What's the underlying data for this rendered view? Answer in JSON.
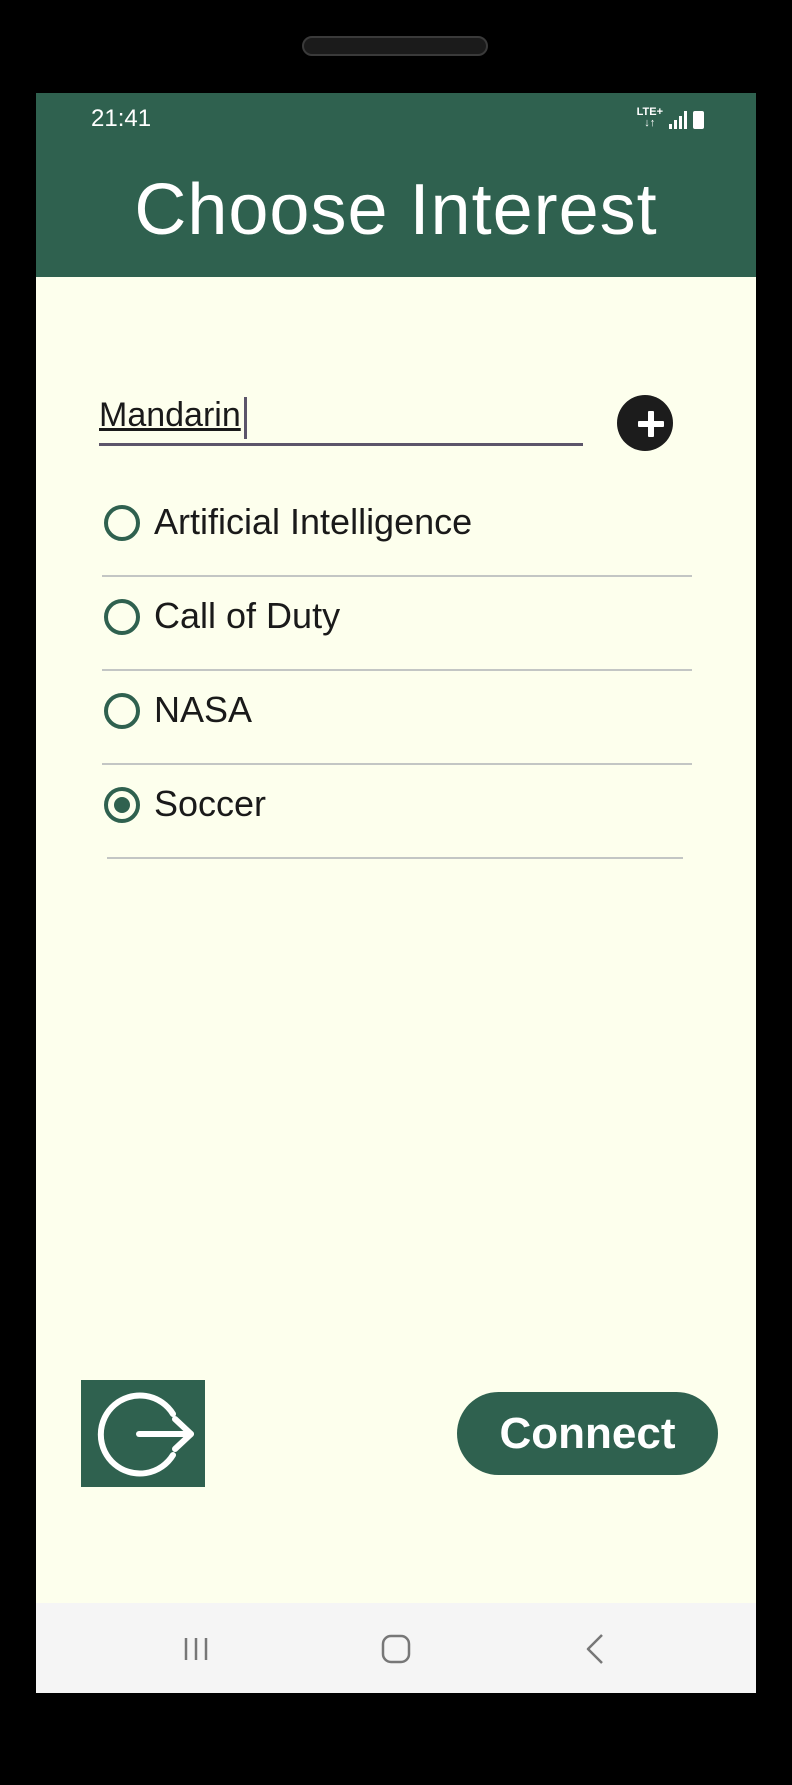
{
  "status_bar": {
    "time": "21:41",
    "network": "LTE+",
    "icons": [
      "lte-icon",
      "signal-icon",
      "battery-charging-icon"
    ]
  },
  "header": {
    "title": "Choose Interest",
    "color": "#2f614f"
  },
  "interest_input": {
    "value": "Mandarin"
  },
  "add_button": {
    "icon": "plus-icon"
  },
  "interests": [
    {
      "label": "Artificial Intelligence",
      "selected": false
    },
    {
      "label": "Call of Duty",
      "selected": false
    },
    {
      "label": "NASA",
      "selected": false
    },
    {
      "label": "Soccer",
      "selected": true
    }
  ],
  "footer": {
    "logout_icon": "logout-icon",
    "connect_label": "Connect"
  },
  "nav_bar": {
    "buttons": [
      "recent-apps-icon",
      "home-icon",
      "back-icon"
    ]
  },
  "colors": {
    "accent": "#2f614f",
    "background": "#fdffed",
    "underline": "#5c556a"
  }
}
